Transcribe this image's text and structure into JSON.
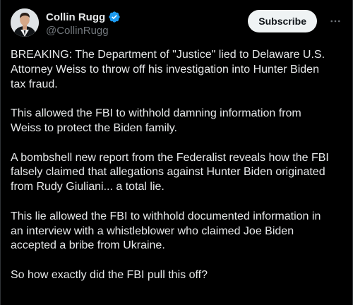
{
  "author": {
    "display_name": "Collin Rugg",
    "handle": "@CollinRugg",
    "verified": true
  },
  "actions": {
    "subscribe_label": "Subscribe",
    "more_icon": "more-horizontal-icon"
  },
  "tweet": {
    "paragraphs": [
      "BREAKING: The Department of \"Justice\" lied to Delaware U.S.\nAttorney Weiss to throw off his investigation into Hunter Biden\ntax fraud.",
      "This allowed the FBI to withhold damning information from\nWeiss to protect the Biden family.",
      "A bombshell new report from the Federalist reveals how the FBI\nfalsely claimed that allegations against Hunter Biden originated\nfrom Rudy Giuliani... a total lie.",
      "This lie allowed the FBI to withhold documented information in\nan interview with a whistleblower who claimed Joe Biden\naccepted a bribe from Ukraine.",
      "So how exactly did the FBI pull this off?"
    ]
  },
  "colors": {
    "background": "#000000",
    "text_primary": "#e7e9ea",
    "text_secondary": "#71767b",
    "verified_blue": "#1d9bf0",
    "button_bg": "#eff3f4"
  }
}
